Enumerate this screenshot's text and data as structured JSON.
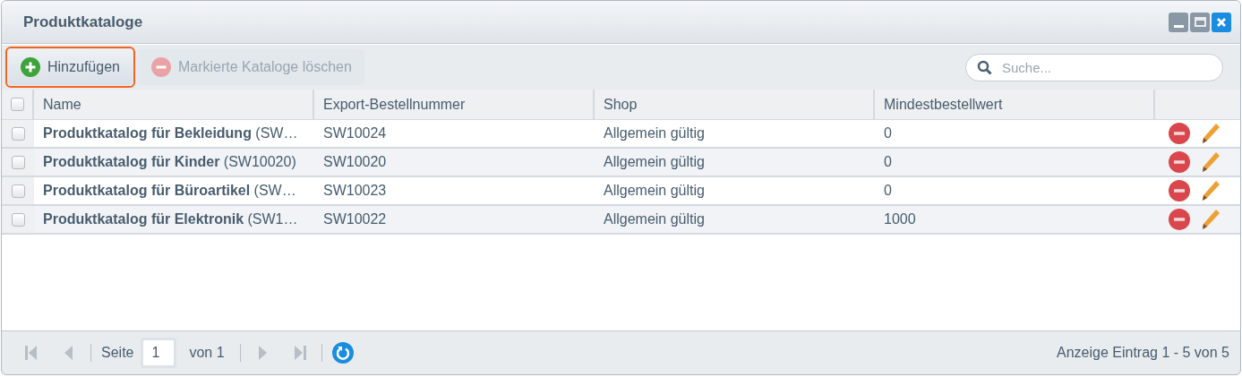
{
  "window": {
    "title": "Produktkataloge"
  },
  "toolbar": {
    "buttons": [
      {
        "kind": "add",
        "label": "Hinzufügen",
        "disabled": false,
        "focused": true
      },
      {
        "kind": "delete",
        "label": "Markierte Kataloge löschen",
        "disabled": true,
        "focused": false
      }
    ],
    "search": {
      "placeholder": "Suche..."
    }
  },
  "table": {
    "all_checked": false,
    "columns": [
      "Name",
      "Export-Bestellnummer",
      "Shop",
      "Mindestbestellwert"
    ],
    "rows": [
      {
        "checked": false,
        "cells": [
          "**Produktkatalog für Bekleidung** (SW…",
          "SW10024",
          "Allgemein gültig",
          "0"
        ]
      },
      {
        "checked": false,
        "cells": [
          "**Produktkatalog für Kinder** (SW10020)",
          "SW10020",
          "Allgemein gültig",
          "0"
        ]
      },
      {
        "checked": false,
        "cells": [
          "**Produktkatalog für Büroartikel** (SW…",
          "SW10023",
          "Allgemein gültig",
          "0"
        ]
      },
      {
        "checked": false,
        "cells": [
          "**Produktkatalog für Elektronik** (SW1…",
          "SW10022",
          "Allgemein gültig",
          "1000"
        ]
      }
    ]
  },
  "pager": {
    "first_disabled": true,
    "prev_disabled": true,
    "next_disabled": true,
    "last_disabled": true,
    "page_label": "Seite",
    "page": "1",
    "of_label": "von 1",
    "summary": "Anzeige Eintrag 1 - 5 von 5"
  }
}
